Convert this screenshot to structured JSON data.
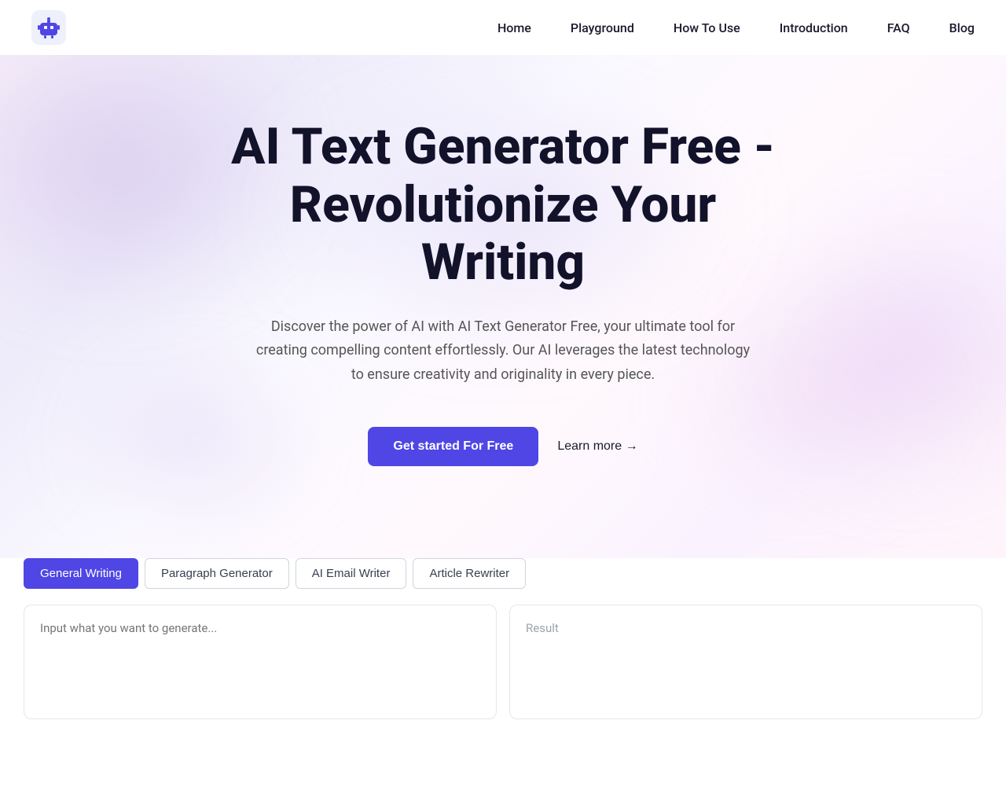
{
  "nav": {
    "logo_alt": "AI Text Generator Logo",
    "links": [
      {
        "id": "home",
        "label": "Home"
      },
      {
        "id": "playground",
        "label": "Playground"
      },
      {
        "id": "how-to-use",
        "label": "How To Use"
      },
      {
        "id": "introduction",
        "label": "Introduction"
      },
      {
        "id": "faq",
        "label": "FAQ"
      },
      {
        "id": "blog",
        "label": "Blog"
      }
    ]
  },
  "hero": {
    "heading": "AI Text Generator Free - Revolutionize Your Writing",
    "subheading": "Discover the power of AI with AI Text Generator Free, your ultimate tool for creating compelling content effortlessly. Our AI leverages the latest technology to ensure creativity and originality in every piece.",
    "cta_primary": "Get started For Free",
    "cta_secondary": "Learn more →"
  },
  "tool": {
    "tabs": [
      {
        "id": "general-writing",
        "label": "General Writing",
        "active": true
      },
      {
        "id": "paragraph-generator",
        "label": "Paragraph Generator",
        "active": false
      },
      {
        "id": "ai-email-writer",
        "label": "AI Email Writer",
        "active": false
      },
      {
        "id": "article-rewriter",
        "label": "Article Rewriter",
        "active": false
      }
    ],
    "input_placeholder": "Input what you want to generate...",
    "result_label": "Result"
  },
  "colors": {
    "accent": "#4f46e5",
    "text_dark": "#12122a",
    "text_mid": "#555",
    "border": "#e5e7eb"
  }
}
